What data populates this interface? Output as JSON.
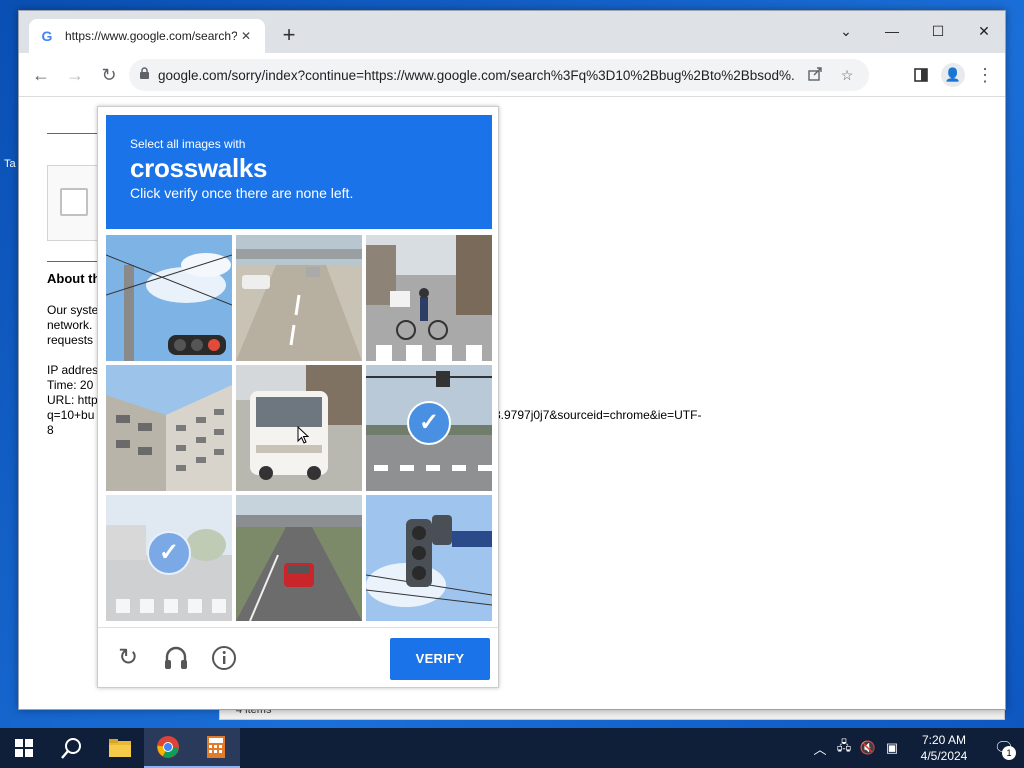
{
  "desktop": {
    "stub_label": "Ta"
  },
  "behind_window": {
    "status_text": "4 items"
  },
  "browser": {
    "tab_title": "https://www.google.com/search?q",
    "tab_favicon": "G",
    "tab_close": "✕",
    "new_tab": "+",
    "window_controls": {
      "tabsearch": "⌄",
      "minimize": "—",
      "maximize": "☐",
      "close": "✕"
    },
    "nav": {
      "back": "←",
      "forward": "→",
      "reload": "↻"
    },
    "url": "google.com/sorry/index?continue=https://www.google.com/search%3Fq%3D10%2Bbug%2Bto%2Bbsod%..."
  },
  "page": {
    "heading": "About th",
    "body_lines": [
      "Our syste",
      "network.",
      "requests"
    ],
    "ip_line": "IP addres",
    "time_line": "Time: 20",
    "url_line": "URL: http",
    "url_line2": "q=10+bu",
    "url_line3": "8",
    "url_tail": "3.9797j0j7&sourceid=chrome&ie=UTF-"
  },
  "captcha": {
    "instruction": "Select all images with",
    "keyword": "crosswalks",
    "sub_instruction": "Click verify once there are none left.",
    "verify_label": "VERIFY",
    "tiles": [
      {
        "name": "traffic-light-sky",
        "selected": false
      },
      {
        "name": "highway-overpass",
        "selected": false
      },
      {
        "name": "street-cyclist-crosswalk",
        "selected": false
      },
      {
        "name": "building-facade",
        "selected": false
      },
      {
        "name": "bus-street",
        "selected": false
      },
      {
        "name": "road-traffic-light",
        "selected": true
      },
      {
        "name": "faded-crosswalk",
        "selected": true
      },
      {
        "name": "red-car-road",
        "selected": false
      },
      {
        "name": "traffic-light-wires",
        "selected": false
      }
    ]
  },
  "taskbar": {
    "time": "7:20 AM",
    "date": "4/5/2024",
    "notification_count": "1"
  }
}
